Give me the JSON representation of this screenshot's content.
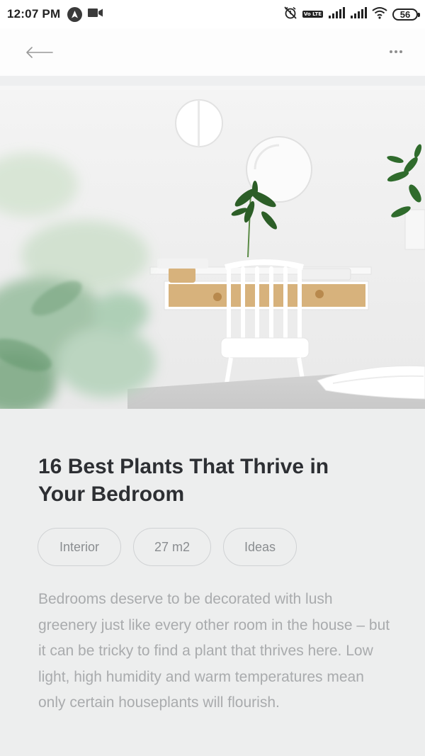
{
  "status_bar": {
    "time": "12:07 PM",
    "battery": "56",
    "lte_label": "Vo LTE",
    "icons": [
      "navigation-icon",
      "video-camera-icon",
      "alarm-off-icon",
      "volte-icon",
      "signal-icon",
      "signal-icon",
      "wifi-icon",
      "battery-icon"
    ]
  },
  "app_bar": {
    "back_icon": "arrow-left-icon",
    "more_icon": "more-horizontal-icon"
  },
  "article": {
    "title": "16 Best Plants That Thrive in Your Bedroom",
    "tags": [
      "Interior",
      "27 m2",
      "Ideas"
    ],
    "description": "Bedrooms deserve to be decorated with lush greenery just like every other room in the house – but it can be tricky to find a plant that thrives here. Low light, high humidity and warm temperatures mean only certain houseplants will flourish."
  },
  "colors": {
    "background": "#eeeff0",
    "title": "#2d2f33",
    "chip_border": "#d0d2d4",
    "chip_text": "#8a8d90",
    "description_text": "#a9abad",
    "drawer_wood": "#d7b27c"
  }
}
